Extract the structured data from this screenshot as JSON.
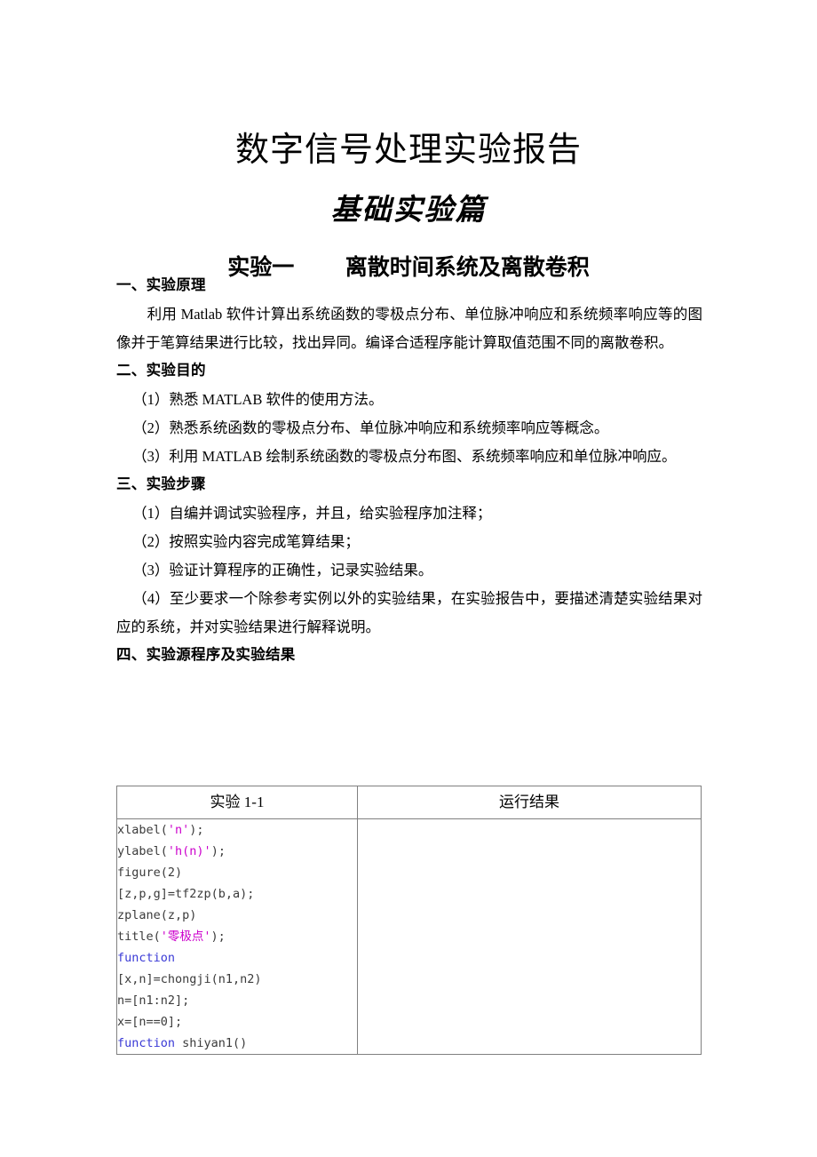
{
  "document": {
    "title": "数字信号处理实验报告",
    "subtitle": "基础实验篇",
    "experiment_heading_left": "实验一",
    "experiment_heading_right": "离散时间系统及离散卷积"
  },
  "sections": [
    {
      "heading": "一、实验原理",
      "paragraphs": [
        "利用 Matlab 软件计算出系统函数的零极点分布、单位脉冲响应和系统频率响应等的图像并于笔算结果进行比较，找出异同。编译合适程序能计算取值范围不同的离散卷积。"
      ]
    },
    {
      "heading": "二、实验目的",
      "paragraphs": [
        "（1）熟悉 MATLAB 软件的使用方法。",
        "（2）熟悉系统函数的零极点分布、单位脉冲响应和系统频率响应等概念。",
        "（3）利用 MATLAB 绘制系统函数的零极点分布图、系统频率响应和单位脉冲响应。"
      ]
    },
    {
      "heading": "三、实验步骤",
      "paragraphs": [
        "（1）自编并调试实验程序，并且，给实验程序加注释；",
        "（2）按照实验内容完成笔算结果；",
        "（3）验证计算程序的正确性，记录实验结果。",
        "（4）至少要求一个除参考实例以外的实验结果，在实验报告中，要描述清楚实验结果对应的系统，并对实验结果进行解释说明。"
      ]
    },
    {
      "heading": "四、实验源程序及实验结果",
      "paragraphs": []
    }
  ],
  "table": {
    "headers": {
      "code_column": "实验 1-1",
      "result_column": "运行结果"
    },
    "code_lines": [
      [
        {
          "t": "xlabel(",
          "c": "plain"
        },
        {
          "t": "'n'",
          "c": "string"
        },
        {
          "t": ");",
          "c": "plain"
        }
      ],
      [
        {
          "t": "ylabel(",
          "c": "plain"
        },
        {
          "t": "'h(n)'",
          "c": "string"
        },
        {
          "t": ");",
          "c": "plain"
        }
      ],
      [
        {
          "t": "figure(2)",
          "c": "plain"
        }
      ],
      [
        {
          "t": "[z,p,g]=tf2zp(b,a);",
          "c": "plain"
        }
      ],
      [
        {
          "t": "zplane(z,p)",
          "c": "plain"
        }
      ],
      [
        {
          "t": "title(",
          "c": "plain"
        },
        {
          "t": "'零极点'",
          "c": "string"
        },
        {
          "t": ");",
          "c": "plain"
        }
      ],
      [
        {
          "t": "function",
          "c": "keyword"
        }
      ],
      [
        {
          "t": "[x,n]=chongji(n1,n2)",
          "c": "plain"
        }
      ],
      [
        {
          "t": "n=[n1:n2];",
          "c": "plain"
        }
      ],
      [
        {
          "t": "x=[n==0];",
          "c": "plain"
        }
      ],
      [
        {
          "t": "function",
          "c": "keyword"
        },
        {
          "t": " shiyan1()",
          "c": "plain"
        }
      ]
    ],
    "result_cell_text": ""
  },
  "colors": {
    "text": "#000000",
    "code_text": "#3b3b3b",
    "string_token": "#cc00cc",
    "keyword_token": "#3a3ad6",
    "table_border": "#808080",
    "page_background": "#ffffff"
  }
}
